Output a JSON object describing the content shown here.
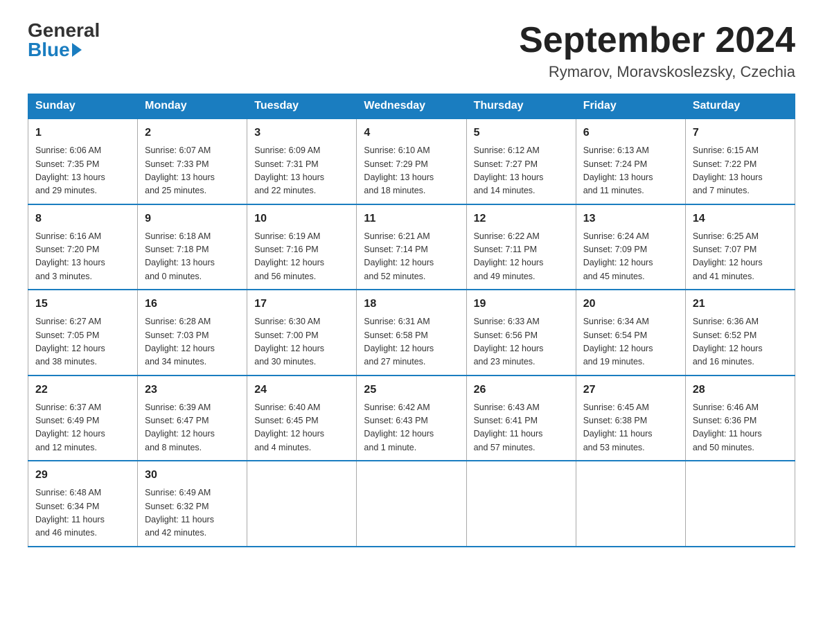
{
  "logo": {
    "general": "General",
    "blue": "Blue"
  },
  "title": "September 2024",
  "location": "Rymarov, Moravskoslezsky, Czechia",
  "weekdays": [
    "Sunday",
    "Monday",
    "Tuesday",
    "Wednesday",
    "Thursday",
    "Friday",
    "Saturday"
  ],
  "weeks": [
    [
      {
        "day": "1",
        "info": "Sunrise: 6:06 AM\nSunset: 7:35 PM\nDaylight: 13 hours\nand 29 minutes."
      },
      {
        "day": "2",
        "info": "Sunrise: 6:07 AM\nSunset: 7:33 PM\nDaylight: 13 hours\nand 25 minutes."
      },
      {
        "day": "3",
        "info": "Sunrise: 6:09 AM\nSunset: 7:31 PM\nDaylight: 13 hours\nand 22 minutes."
      },
      {
        "day": "4",
        "info": "Sunrise: 6:10 AM\nSunset: 7:29 PM\nDaylight: 13 hours\nand 18 minutes."
      },
      {
        "day": "5",
        "info": "Sunrise: 6:12 AM\nSunset: 7:27 PM\nDaylight: 13 hours\nand 14 minutes."
      },
      {
        "day": "6",
        "info": "Sunrise: 6:13 AM\nSunset: 7:24 PM\nDaylight: 13 hours\nand 11 minutes."
      },
      {
        "day": "7",
        "info": "Sunrise: 6:15 AM\nSunset: 7:22 PM\nDaylight: 13 hours\nand 7 minutes."
      }
    ],
    [
      {
        "day": "8",
        "info": "Sunrise: 6:16 AM\nSunset: 7:20 PM\nDaylight: 13 hours\nand 3 minutes."
      },
      {
        "day": "9",
        "info": "Sunrise: 6:18 AM\nSunset: 7:18 PM\nDaylight: 13 hours\nand 0 minutes."
      },
      {
        "day": "10",
        "info": "Sunrise: 6:19 AM\nSunset: 7:16 PM\nDaylight: 12 hours\nand 56 minutes."
      },
      {
        "day": "11",
        "info": "Sunrise: 6:21 AM\nSunset: 7:14 PM\nDaylight: 12 hours\nand 52 minutes."
      },
      {
        "day": "12",
        "info": "Sunrise: 6:22 AM\nSunset: 7:11 PM\nDaylight: 12 hours\nand 49 minutes."
      },
      {
        "day": "13",
        "info": "Sunrise: 6:24 AM\nSunset: 7:09 PM\nDaylight: 12 hours\nand 45 minutes."
      },
      {
        "day": "14",
        "info": "Sunrise: 6:25 AM\nSunset: 7:07 PM\nDaylight: 12 hours\nand 41 minutes."
      }
    ],
    [
      {
        "day": "15",
        "info": "Sunrise: 6:27 AM\nSunset: 7:05 PM\nDaylight: 12 hours\nand 38 minutes."
      },
      {
        "day": "16",
        "info": "Sunrise: 6:28 AM\nSunset: 7:03 PM\nDaylight: 12 hours\nand 34 minutes."
      },
      {
        "day": "17",
        "info": "Sunrise: 6:30 AM\nSunset: 7:00 PM\nDaylight: 12 hours\nand 30 minutes."
      },
      {
        "day": "18",
        "info": "Sunrise: 6:31 AM\nSunset: 6:58 PM\nDaylight: 12 hours\nand 27 minutes."
      },
      {
        "day": "19",
        "info": "Sunrise: 6:33 AM\nSunset: 6:56 PM\nDaylight: 12 hours\nand 23 minutes."
      },
      {
        "day": "20",
        "info": "Sunrise: 6:34 AM\nSunset: 6:54 PM\nDaylight: 12 hours\nand 19 minutes."
      },
      {
        "day": "21",
        "info": "Sunrise: 6:36 AM\nSunset: 6:52 PM\nDaylight: 12 hours\nand 16 minutes."
      }
    ],
    [
      {
        "day": "22",
        "info": "Sunrise: 6:37 AM\nSunset: 6:49 PM\nDaylight: 12 hours\nand 12 minutes."
      },
      {
        "day": "23",
        "info": "Sunrise: 6:39 AM\nSunset: 6:47 PM\nDaylight: 12 hours\nand 8 minutes."
      },
      {
        "day": "24",
        "info": "Sunrise: 6:40 AM\nSunset: 6:45 PM\nDaylight: 12 hours\nand 4 minutes."
      },
      {
        "day": "25",
        "info": "Sunrise: 6:42 AM\nSunset: 6:43 PM\nDaylight: 12 hours\nand 1 minute."
      },
      {
        "day": "26",
        "info": "Sunrise: 6:43 AM\nSunset: 6:41 PM\nDaylight: 11 hours\nand 57 minutes."
      },
      {
        "day": "27",
        "info": "Sunrise: 6:45 AM\nSunset: 6:38 PM\nDaylight: 11 hours\nand 53 minutes."
      },
      {
        "day": "28",
        "info": "Sunrise: 6:46 AM\nSunset: 6:36 PM\nDaylight: 11 hours\nand 50 minutes."
      }
    ],
    [
      {
        "day": "29",
        "info": "Sunrise: 6:48 AM\nSunset: 6:34 PM\nDaylight: 11 hours\nand 46 minutes."
      },
      {
        "day": "30",
        "info": "Sunrise: 6:49 AM\nSunset: 6:32 PM\nDaylight: 11 hours\nand 42 minutes."
      },
      {
        "day": "",
        "info": ""
      },
      {
        "day": "",
        "info": ""
      },
      {
        "day": "",
        "info": ""
      },
      {
        "day": "",
        "info": ""
      },
      {
        "day": "",
        "info": ""
      }
    ]
  ]
}
